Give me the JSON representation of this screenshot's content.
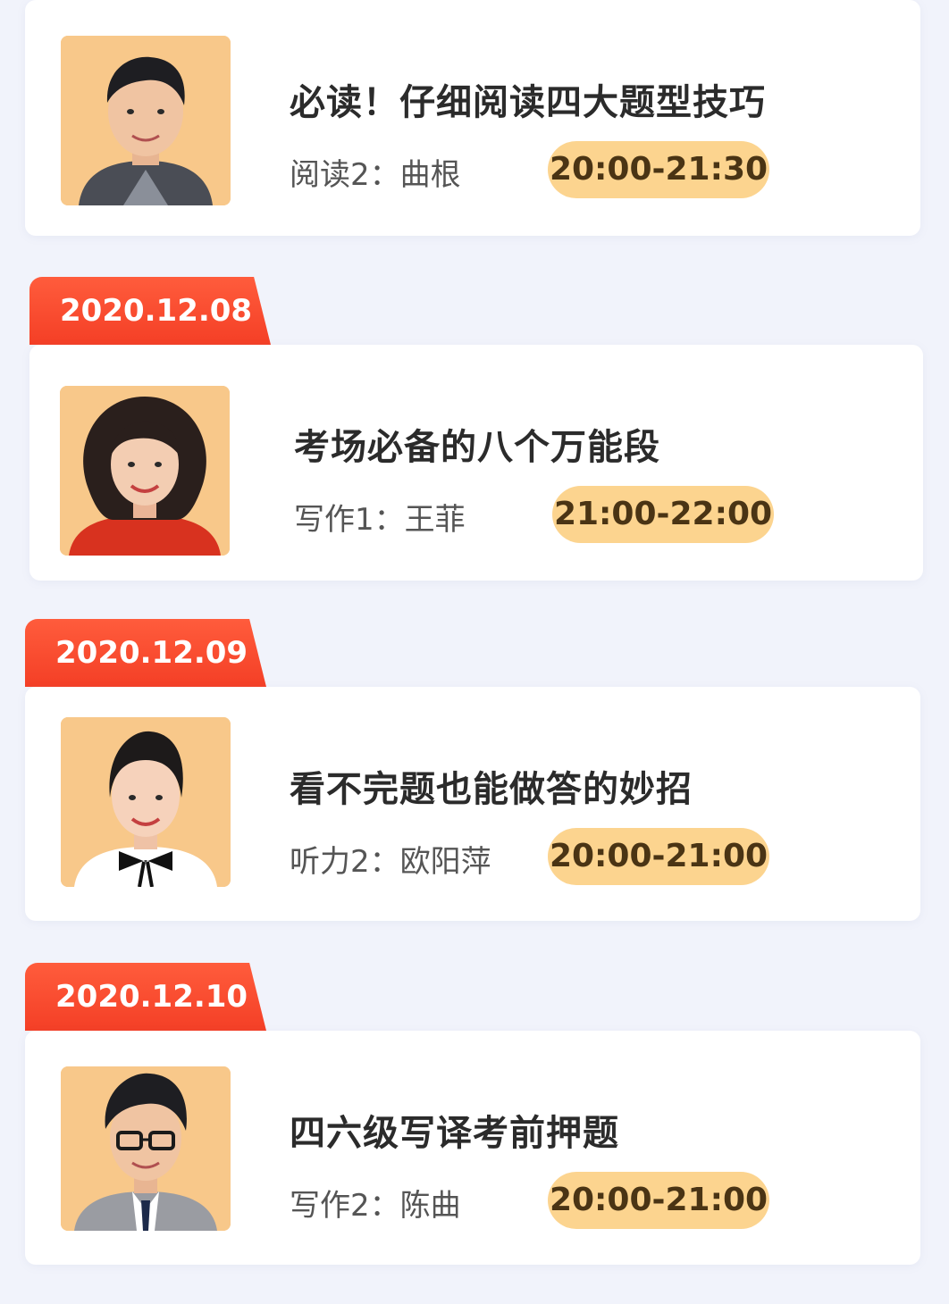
{
  "sessions": [
    {
      "date": "",
      "title": "必读！仔细阅读四大题型技巧",
      "teacher": "阅读2：曲根",
      "time": "20:00-21:30",
      "avatar_icon": "teacher-male-photo"
    },
    {
      "date": "2020.12.08",
      "title": "考场必备的八个万能段",
      "teacher": "写作1：王菲",
      "time": "21:00-22:00",
      "avatar_icon": "teacher-female-photo"
    },
    {
      "date": "2020.12.09",
      "title": "看不完题也能做答的妙招",
      "teacher": "听力2：欧阳萍",
      "time": "20:00-21:00",
      "avatar_icon": "teacher-female-photo"
    },
    {
      "date": "2020.12.10",
      "title": "四六级写译考前押题",
      "teacher": "写作2：陈曲",
      "time": "20:00-21:00",
      "avatar_icon": "teacher-male-glasses-photo"
    }
  ],
  "colors": {
    "date_tab": "#f43f26",
    "time_pill": "#fcd48f",
    "photo_bg": "#f8c88a",
    "page_bg": "#f1f3fb"
  }
}
